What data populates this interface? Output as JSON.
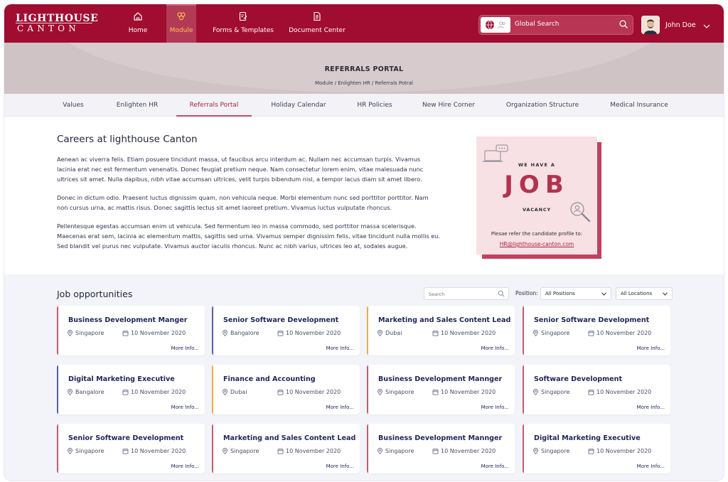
{
  "brand": {
    "line1": "LIGHTHOUSE",
    "line2": "CANTON"
  },
  "nav": [
    {
      "label": "Home",
      "icon": "home-icon"
    },
    {
      "label": "Module",
      "icon": "module-icon",
      "active": true
    },
    {
      "label": "Forms & Templates",
      "icon": "forms-icon"
    },
    {
      "label": "Document Center",
      "icon": "document-icon"
    }
  ],
  "search": {
    "placeholder": "Global Search"
  },
  "user": {
    "name": "John Doe"
  },
  "banner": {
    "title": "REFERRALS PORTAL",
    "breadcrumb": "Module / Enlighten HR / Referrals Potral"
  },
  "tabs": [
    "Values",
    "Enlighten HR",
    "Referrals Portal",
    "Holiday Calendar",
    "HR Policies",
    "New Hire Corner",
    "Organization Structure",
    "Medical Insurance"
  ],
  "careers": {
    "title": "Careers at lighthouse Canton",
    "p1": "Aenean ac viverra felis. Etiam posuere tincidunt massa, ut faucibus arcu interdum ac. Nullam nec accumsan turpis. Vivamus lacinia erat nec est fermentum venenatis. Donec feugiat pretium neque. Nam consectetur lorem enim, vitae malesuada nunc ultrices sit amet. Nulla dapibus, nibh vitae accumsan ultrices, velit turpis bibendum nisl, a tempor lacus diam sit amet libero.",
    "p2": "Donec in dictum odio. Praesent luctus dignissim quam, non vehicula neque. Morbi elementum nunc sed porttitor porttitor. Nam non cursus urna, ac mattis risus. Donec sagittis lectus sit amet laoreet pretium. Vivamus luctus vulputate rhoncus.",
    "p3": "Pellentesque egestas accumsan enim ut vehicula. Sed fermentum leo in massa commodo, sed porttitor massa scelerisque. Maecenas erat sem, lacinia ac elementum mattis, sagittis sed urna. Vivamus semper dignissim felis, vitae tincidunt nulla mollis eu. Sed blandit vel purus nec vulputate. Vivamus auctor iaculis rhoncus. Nunc ac nibh varius, ultrices leo at, sodales augue."
  },
  "promo": {
    "we_have": "WE HAVE A",
    "job": "JOB",
    "vacancy": "VACANCY",
    "refer": "Plesae refer the candidate profile to:",
    "email": "HR@lighthouse-canton.com"
  },
  "opportunities": {
    "title": "Job opportunities",
    "search_placeholder": "Search",
    "position_label": "Position:",
    "position_value": "All Positions",
    "location_value": "All Locations",
    "more_label": "More Info...",
    "jobs": [
      {
        "title": "Business Development Manger",
        "location": "Singapore",
        "date": "10 November 2020",
        "accent": "#c85a6c"
      },
      {
        "title": "Senior Software Development",
        "location": "Bangalore",
        "date": "10 November 2020",
        "accent": "#5b5fa0"
      },
      {
        "title": "Marketing and Sales Content Lead",
        "location": "Dubai",
        "date": "10 November 2020",
        "accent": "#e8b03a"
      },
      {
        "title": "Senior Software Development",
        "location": "Singapore",
        "date": "10 November 2020",
        "accent": "#c85a6c"
      },
      {
        "title": "Digital Marketing Executive",
        "location": "Bangalore",
        "date": "10 November 2020",
        "accent": "#5b5fa0"
      },
      {
        "title": "Finance and Accounting",
        "location": "Dubai",
        "date": "10 November 2020",
        "accent": "#e8b03a"
      },
      {
        "title": "Business Development Mannger",
        "location": "Singapore",
        "date": "10 November 2020",
        "accent": "#c85a6c"
      },
      {
        "title": "Software Development",
        "location": "Singapore",
        "date": "10 November 2020",
        "accent": "#c85a6c"
      },
      {
        "title": "Senior Software Development",
        "location": "Singapore",
        "date": "10 November 2020",
        "accent": "#c85a6c"
      },
      {
        "title": "Marketing and Sales Content Lead",
        "location": "Singapore",
        "date": "10 November 2020",
        "accent": "#c85a6c"
      },
      {
        "title": "Business Development Mannger",
        "location": "Singapore",
        "date": "10 November 2020",
        "accent": "#c85a6c"
      },
      {
        "title": "Digital Marketing Executive",
        "location": "Singapore",
        "date": "10 November 2020",
        "accent": "#c85a6c"
      }
    ]
  },
  "colors": {
    "brand": "#a10d30",
    "active_nav": "#ffc247",
    "tab_active": "#b0203f"
  }
}
